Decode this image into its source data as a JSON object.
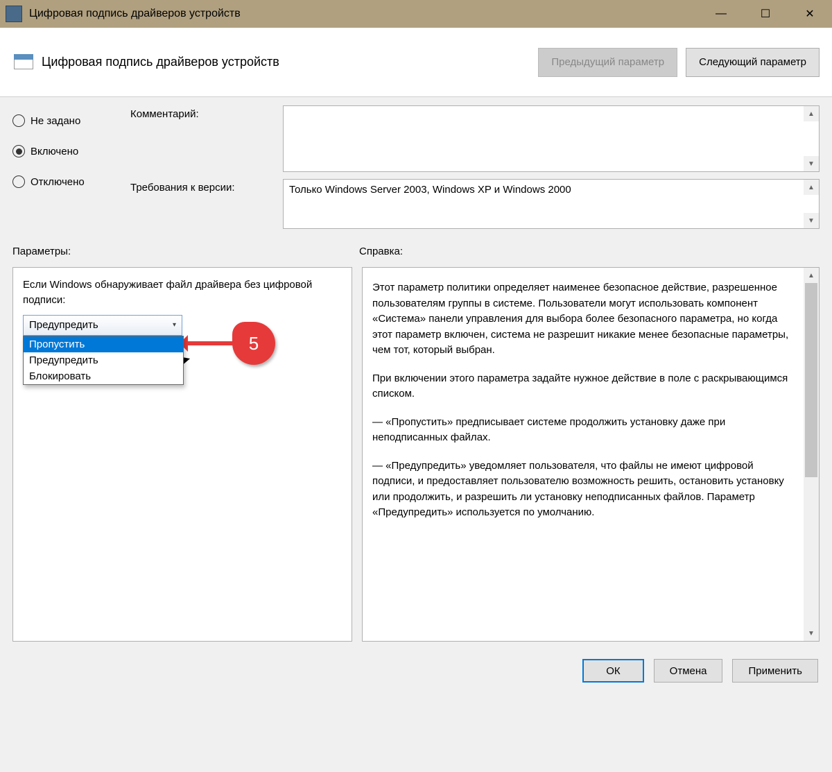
{
  "window": {
    "title": "Цифровая подпись драйверов устройств",
    "minimize": "—",
    "maximize": "☐",
    "close": "✕"
  },
  "header": {
    "title": "Цифровая подпись драйверов устройств",
    "prev": "Предыдущий параметр",
    "next": "Следующий параметр"
  },
  "radios": {
    "not_set": "Не задано",
    "enabled": "Включено",
    "disabled": "Отключено",
    "selected": "enabled"
  },
  "fields": {
    "comment_label": "Комментарий:",
    "comment_value": "",
    "version_label": "Требования к версии:",
    "version_value": "Только Windows Server 2003, Windows XP и Windows 2000"
  },
  "sections": {
    "params": "Параметры:",
    "help": "Справка:"
  },
  "params": {
    "prompt": "Если Windows обнаруживает файл драйвера без цифровой подписи:",
    "selected": "Предупредить",
    "options": [
      "Пропустить",
      "Предупредить",
      "Блокировать"
    ],
    "highlighted": "Пропустить",
    "callout": "5"
  },
  "help": {
    "p1": "Этот параметр политики определяет наименее безопасное действие, разрешенное пользователям группы в системе. Пользователи могут использовать компонент «Система» панели управления для выбора более безопасного параметра, но когда этот параметр включен, система не разрешит никакие менее безопасные параметры, чем тот, который выбран.",
    "p2": "При включении этого параметра задайте нужное действие в поле с раскрывающимся списком.",
    "p3": "— «Пропустить» предписывает системе продолжить установку даже при неподписанных файлах.",
    "p4": "— «Предупредить» уведомляет пользователя, что файлы не имеют цифровой подписи, и предоставляет пользователю возможность решить, остановить установку или продолжить, и разрешить ли установку неподписанных файлов. Параметр «Предупредить» используется по умолчанию."
  },
  "footer": {
    "ok": "ОК",
    "cancel": "Отмена",
    "apply": "Применить"
  }
}
